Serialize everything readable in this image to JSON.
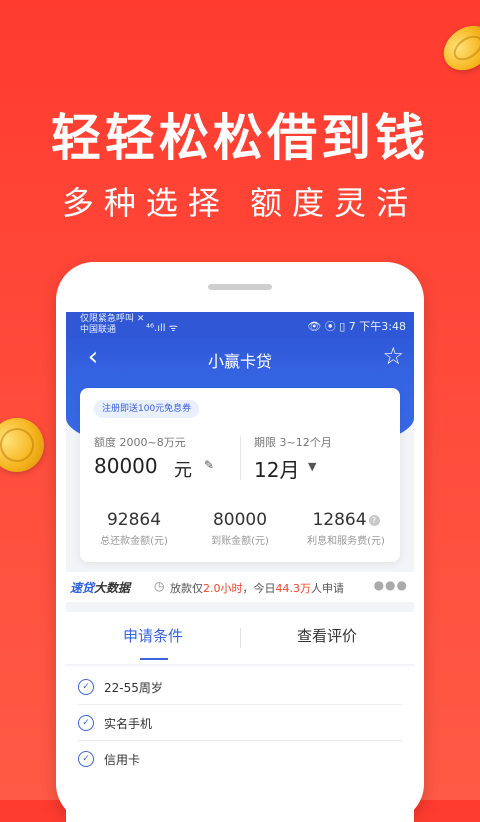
{
  "promo": {
    "headline": "轻轻松松借到钱",
    "subline": "多种选择 额度灵活"
  },
  "statusbar": {
    "carrier_line1": "仅限紧急呼叫 ✕",
    "carrier_line2": "中国联通",
    "signal": "⁴⁶.ıll ᯤ",
    "icons": "👁 ⦿ ▯ 7",
    "time": "下午3:48"
  },
  "navbar": {
    "back_icon": "‹",
    "title": "小赢卡贷",
    "favorite_icon": "☆"
  },
  "loan_card": {
    "promo_badge": "注册即送100元免息券",
    "amount_label": "额度 2000~8万元",
    "amount_value": "80000",
    "amount_unit": "元",
    "term_label": "期限 3~12个月",
    "term_value": "12月",
    "stats": [
      {
        "value": "92864",
        "label": "总还款金额(元)"
      },
      {
        "value": "80000",
        "label": "到账金额(元)"
      },
      {
        "value": "12864",
        "label": "利息和服务费(元)"
      }
    ]
  },
  "bigdata": {
    "brand_part1": "速贷",
    "brand_part2": "大数据",
    "msg_prefix": "放款仅",
    "msg_time": "2.0小时",
    "msg_mid": "，今日",
    "msg_count": "44.3万",
    "msg_suffix": "人申请"
  },
  "tabs": [
    {
      "label": "申请条件",
      "active": true
    },
    {
      "label": "查看评价",
      "active": false
    }
  ],
  "conditions": [
    {
      "text": "22-55周岁"
    },
    {
      "text": "实名手机"
    },
    {
      "text": "信用卡"
    }
  ],
  "colors": {
    "promo_bg": "#ff3b2f",
    "brand_blue": "#3564e2",
    "highlight_red": "#f0452d"
  }
}
